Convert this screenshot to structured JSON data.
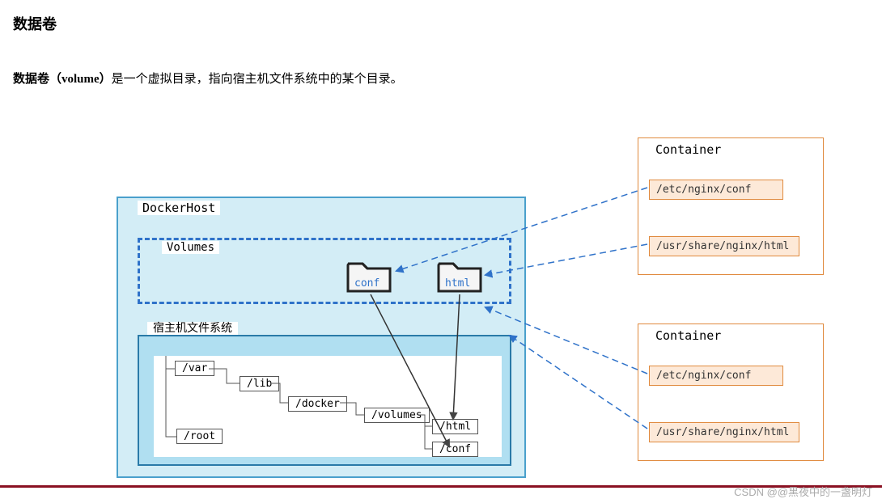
{
  "title": "数据卷",
  "subtitle_bold": "数据卷（volume）",
  "subtitle_rest": "是一个虚拟目录，指向宿主机文件系统中的某个目录。",
  "dockerhost_label": "DockerHost",
  "volumes_label": "Volumes",
  "folders": {
    "conf": "conf",
    "html": "html"
  },
  "host_label": "宿主机文件系统",
  "nodes": {
    "var": "/var",
    "lib": "/lib",
    "docker": "/docker",
    "volumes": "/volumes",
    "html": "/html",
    "conf": "/conf",
    "root": "/root"
  },
  "container_label": "Container",
  "paths": {
    "p1": "/etc/nginx/conf",
    "p2": "/usr/share/nginx/html",
    "p3": "/etc/nginx/conf",
    "p4": "/usr/share/nginx/html"
  },
  "watermark": "CSDN @@黑夜中的一盏明灯"
}
